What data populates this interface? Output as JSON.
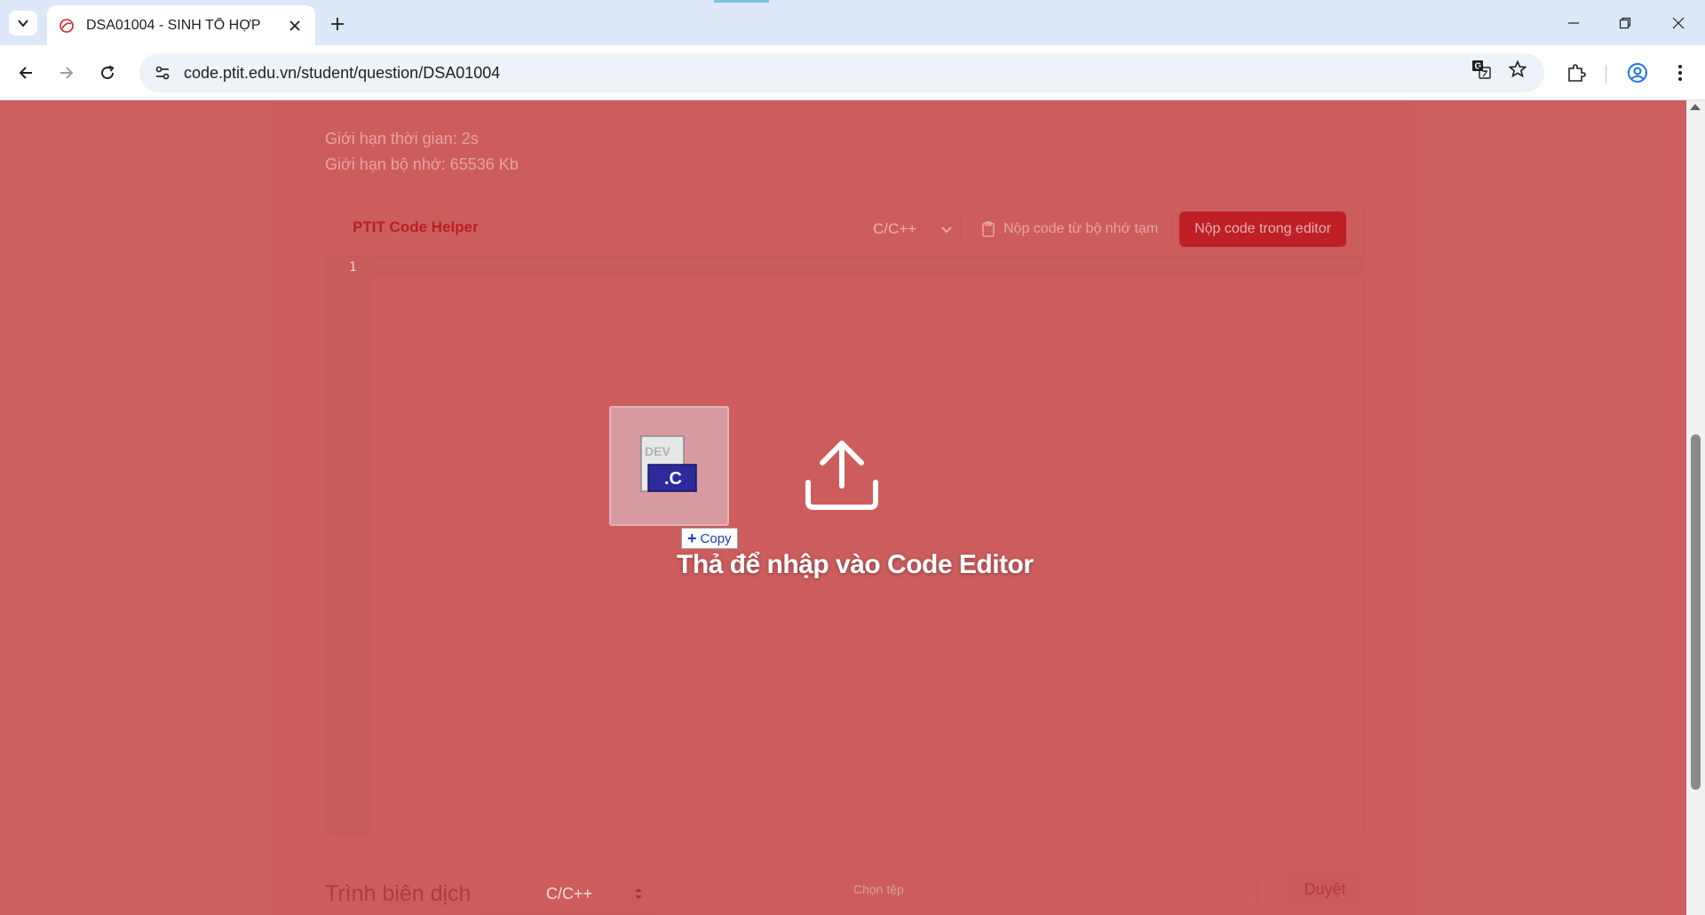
{
  "browser": {
    "tab_title": "DSA01004 - SINH TỔ HỢP",
    "url": "code.ptit.edu.vn/student/question/DSA01004"
  },
  "problem": {
    "time_limit": "Giới hạn thời gian: 2s",
    "memory_limit": "Giới hạn bộ nhớ: 65536 Kb"
  },
  "editor": {
    "brand": "PTIT Code Helper",
    "language": "C/C++",
    "clipboard_button": "Nộp code từ bộ nhớ tạm",
    "submit_button": "Nộp code trong editor",
    "line_number": "1",
    "drop_message": "Thả để nhập vào Code Editor"
  },
  "drag": {
    "file_extension": ".C",
    "file_brand": "DEV",
    "copy_tooltip": "Copy"
  },
  "submission": {
    "compiler_label": "Trình biên dịch",
    "compiler_value": "C/C++",
    "file_placeholder": "Chọn tệp",
    "browse_button": "Duyệt"
  },
  "colors": {
    "overlay": "#cc5e5e",
    "brand_red": "#bf2025",
    "tooltip_text": "#1a3fae"
  }
}
